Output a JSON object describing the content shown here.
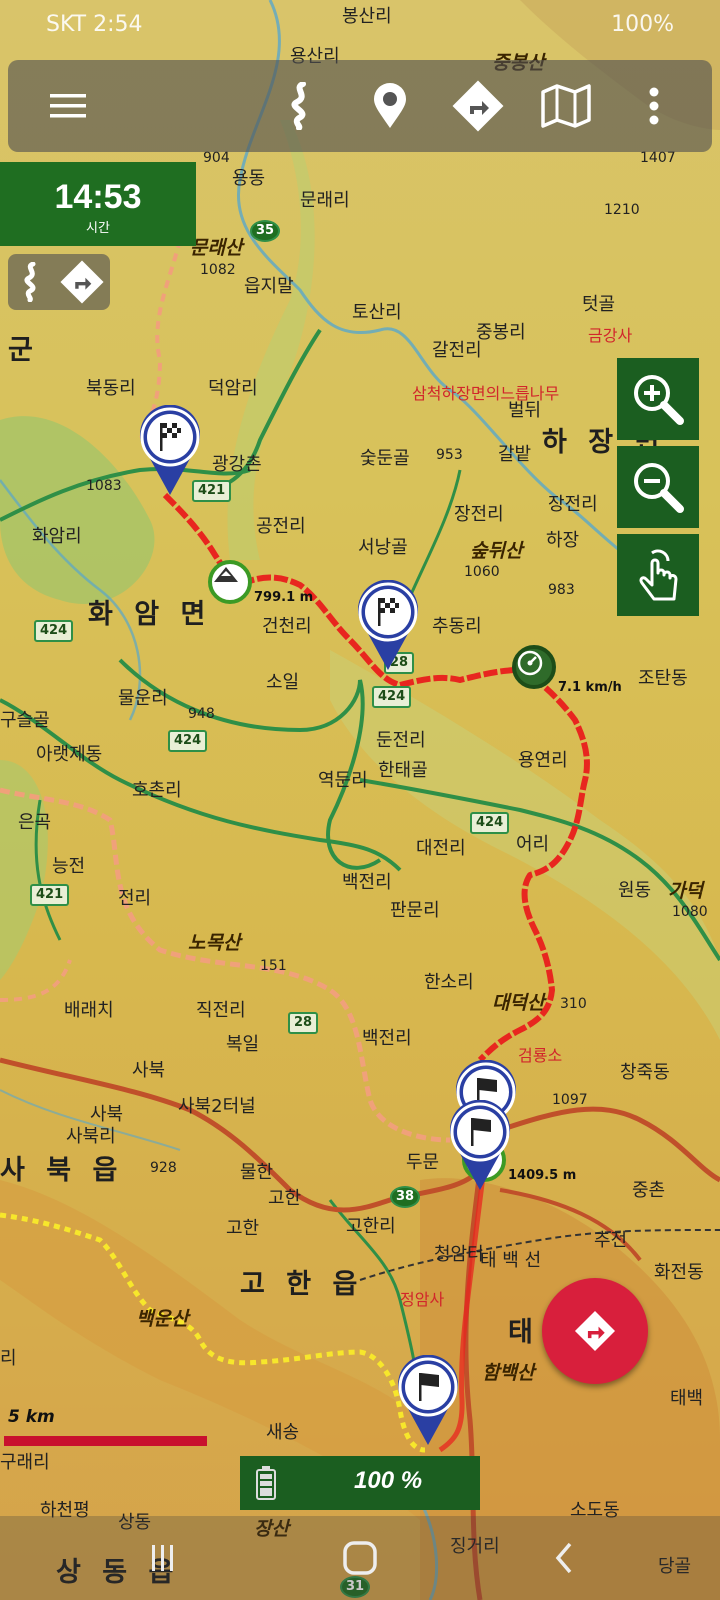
{
  "status_bar": {
    "left": "SKT 2:54",
    "right": "100%"
  },
  "toolbar": {
    "menu_icon": "menu-icon",
    "route_icon": "route-icon",
    "location_icon": "location-pin-icon",
    "navigate_icon": "turn-right-icon",
    "map_icon": "map-icon",
    "more_icon": "more-vertical-icon"
  },
  "time_widget": {
    "value": "14:53",
    "label": "시간"
  },
  "map": {
    "places": [
      {
        "text": "봉산리",
        "cls": ""
      },
      {
        "text": "용산리",
        "cls": ""
      },
      {
        "text": "중봉산",
        "cls": "peak"
      },
      {
        "text": "904",
        "cls": "small"
      },
      {
        "text": "용동",
        "cls": ""
      },
      {
        "text": "문래리",
        "cls": ""
      },
      {
        "text": "문래산",
        "cls": "peak"
      },
      {
        "text": "1082",
        "cls": "small"
      },
      {
        "text": "1210",
        "cls": "small"
      },
      {
        "text": "1407",
        "cls": "small"
      },
      {
        "text": "읍지말",
        "cls": ""
      },
      {
        "text": "토산리",
        "cls": ""
      },
      {
        "text": "갈전리",
        "cls": ""
      },
      {
        "text": "중봉리",
        "cls": ""
      },
      {
        "text": "텃골",
        "cls": ""
      },
      {
        "text": "금강사",
        "cls": "red"
      },
      {
        "text": "군",
        "cls": "big"
      },
      {
        "text": "북동리",
        "cls": ""
      },
      {
        "text": "덕암리",
        "cls": ""
      },
      {
        "text": "삼척하장면의느릅나무",
        "cls": "red"
      },
      {
        "text": "벌뒤",
        "cls": ""
      },
      {
        "text": "하 장 면",
        "cls": "big"
      },
      {
        "text": "광강촌",
        "cls": ""
      },
      {
        "text": "953",
        "cls": "small"
      },
      {
        "text": "갈밭",
        "cls": ""
      },
      {
        "text": "1083",
        "cls": "small"
      },
      {
        "text": "숯둔골",
        "cls": ""
      },
      {
        "text": "장전리",
        "cls": ""
      },
      {
        "text": "장전리",
        "cls": ""
      },
      {
        "text": "공전리",
        "cls": ""
      },
      {
        "text": "서낭골",
        "cls": ""
      },
      {
        "text": "숲뒤산",
        "cls": "peak"
      },
      {
        "text": "화암리",
        "cls": ""
      },
      {
        "text": "1060",
        "cls": "small"
      },
      {
        "text": "하장",
        "cls": ""
      },
      {
        "text": "화 암 면",
        "cls": "big"
      },
      {
        "text": "건천리",
        "cls": ""
      },
      {
        "text": "추동리",
        "cls": ""
      },
      {
        "text": "983",
        "cls": "small"
      },
      {
        "text": "조탄동",
        "cls": ""
      },
      {
        "text": "소일",
        "cls": ""
      },
      {
        "text": "물운리",
        "cls": ""
      },
      {
        "text": "948",
        "cls": "small"
      },
      {
        "text": "구슬골",
        "cls": ""
      },
      {
        "text": "아랫제동",
        "cls": ""
      },
      {
        "text": "둔전리",
        "cls": ""
      },
      {
        "text": "용연리",
        "cls": ""
      },
      {
        "text": "한태골",
        "cls": ""
      },
      {
        "text": "호촌리",
        "cls": ""
      },
      {
        "text": "역둔리",
        "cls": ""
      },
      {
        "text": "은곡",
        "cls": ""
      },
      {
        "text": "대전리",
        "cls": ""
      },
      {
        "text": "어리",
        "cls": ""
      },
      {
        "text": "능전",
        "cls": ""
      },
      {
        "text": "백전리",
        "cls": ""
      },
      {
        "text": "원동",
        "cls": ""
      },
      {
        "text": "전리",
        "cls": ""
      },
      {
        "text": "판문리",
        "cls": ""
      },
      {
        "text": "가덕",
        "cls": "peak"
      },
      {
        "text": "1080",
        "cls": "small"
      },
      {
        "text": "노목산",
        "cls": "peak"
      },
      {
        "text": "151",
        "cls": "small"
      },
      {
        "text": "한소리",
        "cls": ""
      },
      {
        "text": "배래치",
        "cls": ""
      },
      {
        "text": "직전리",
        "cls": ""
      },
      {
        "text": "대덕산",
        "cls": "peak"
      },
      {
        "text": "310",
        "cls": "small"
      },
      {
        "text": "복일",
        "cls": ""
      },
      {
        "text": "백전리",
        "cls": ""
      },
      {
        "text": "검룡소",
        "cls": "red"
      },
      {
        "text": "사북",
        "cls": ""
      },
      {
        "text": "창죽동",
        "cls": ""
      },
      {
        "text": "사북",
        "cls": ""
      },
      {
        "text": "사북2터널",
        "cls": ""
      },
      {
        "text": "1097",
        "cls": "small"
      },
      {
        "text": "사북리",
        "cls": ""
      },
      {
        "text": "두문",
        "cls": ""
      },
      {
        "text": "사 북 읍",
        "cls": "big"
      },
      {
        "text": "928",
        "cls": "small"
      },
      {
        "text": "물한",
        "cls": ""
      },
      {
        "text": "고한",
        "cls": ""
      },
      {
        "text": "중촌",
        "cls": ""
      },
      {
        "text": "고한",
        "cls": ""
      },
      {
        "text": "고한리",
        "cls": ""
      },
      {
        "text": "추전",
        "cls": ""
      },
      {
        "text": "청암터",
        "cls": ""
      },
      {
        "text": "태 백 선",
        "cls": ""
      },
      {
        "text": "고 한 읍",
        "cls": "big"
      },
      {
        "text": "화전동",
        "cls": ""
      },
      {
        "text": "백운산",
        "cls": "peak"
      },
      {
        "text": "정암사",
        "cls": "red"
      },
      {
        "text": "리",
        "cls": ""
      },
      {
        "text": "함백산",
        "cls": "peak"
      },
      {
        "text": "태백",
        "cls": ""
      },
      {
        "text": "태",
        "cls": "big"
      },
      {
        "text": "새송",
        "cls": ""
      },
      {
        "text": "구래리",
        "cls": ""
      },
      {
        "text": "하천평",
        "cls": ""
      },
      {
        "text": "상동",
        "cls": ""
      },
      {
        "text": "장산",
        "cls": "peak"
      },
      {
        "text": "소도동",
        "cls": ""
      },
      {
        "text": "징거리",
        "cls": ""
      },
      {
        "text": "상 동 읍",
        "cls": "big"
      },
      {
        "text": "당골",
        "cls": ""
      }
    ],
    "route_labels": {
      "r424a": "424",
      "r421a": "421",
      "r424b": "424",
      "r424c": "424",
      "r424d": "424",
      "r421b": "421",
      "r28a": "28",
      "r28b": "28",
      "r38": "38",
      "r35": "35",
      "r31": "31"
    },
    "waypoint_labels": {
      "peak_799": "799.1 m",
      "speed": "7.1 km/h",
      "peak_1409": "1409.5 m"
    }
  },
  "zoom_controls": {
    "zoom_in_icon": "zoom-in-icon",
    "zoom_out_icon": "zoom-out-icon",
    "touch_icon": "touch-gesture-icon"
  },
  "fab": {
    "icon": "navigate-icon"
  },
  "scale": {
    "label": "5 km"
  },
  "battery": {
    "value": "100 %",
    "icon": "battery-icon"
  },
  "nav_bar": {
    "recents_icon": "recents-icon",
    "home_icon": "home-icon",
    "back_icon": "back-icon"
  },
  "colors": {
    "route_red": "#e8261f",
    "toolbar_green": "#1b5e20",
    "fab_red": "#d81f3c",
    "trail_yellow": "#f7e72b",
    "pin_blue": "#2a3fa3"
  }
}
